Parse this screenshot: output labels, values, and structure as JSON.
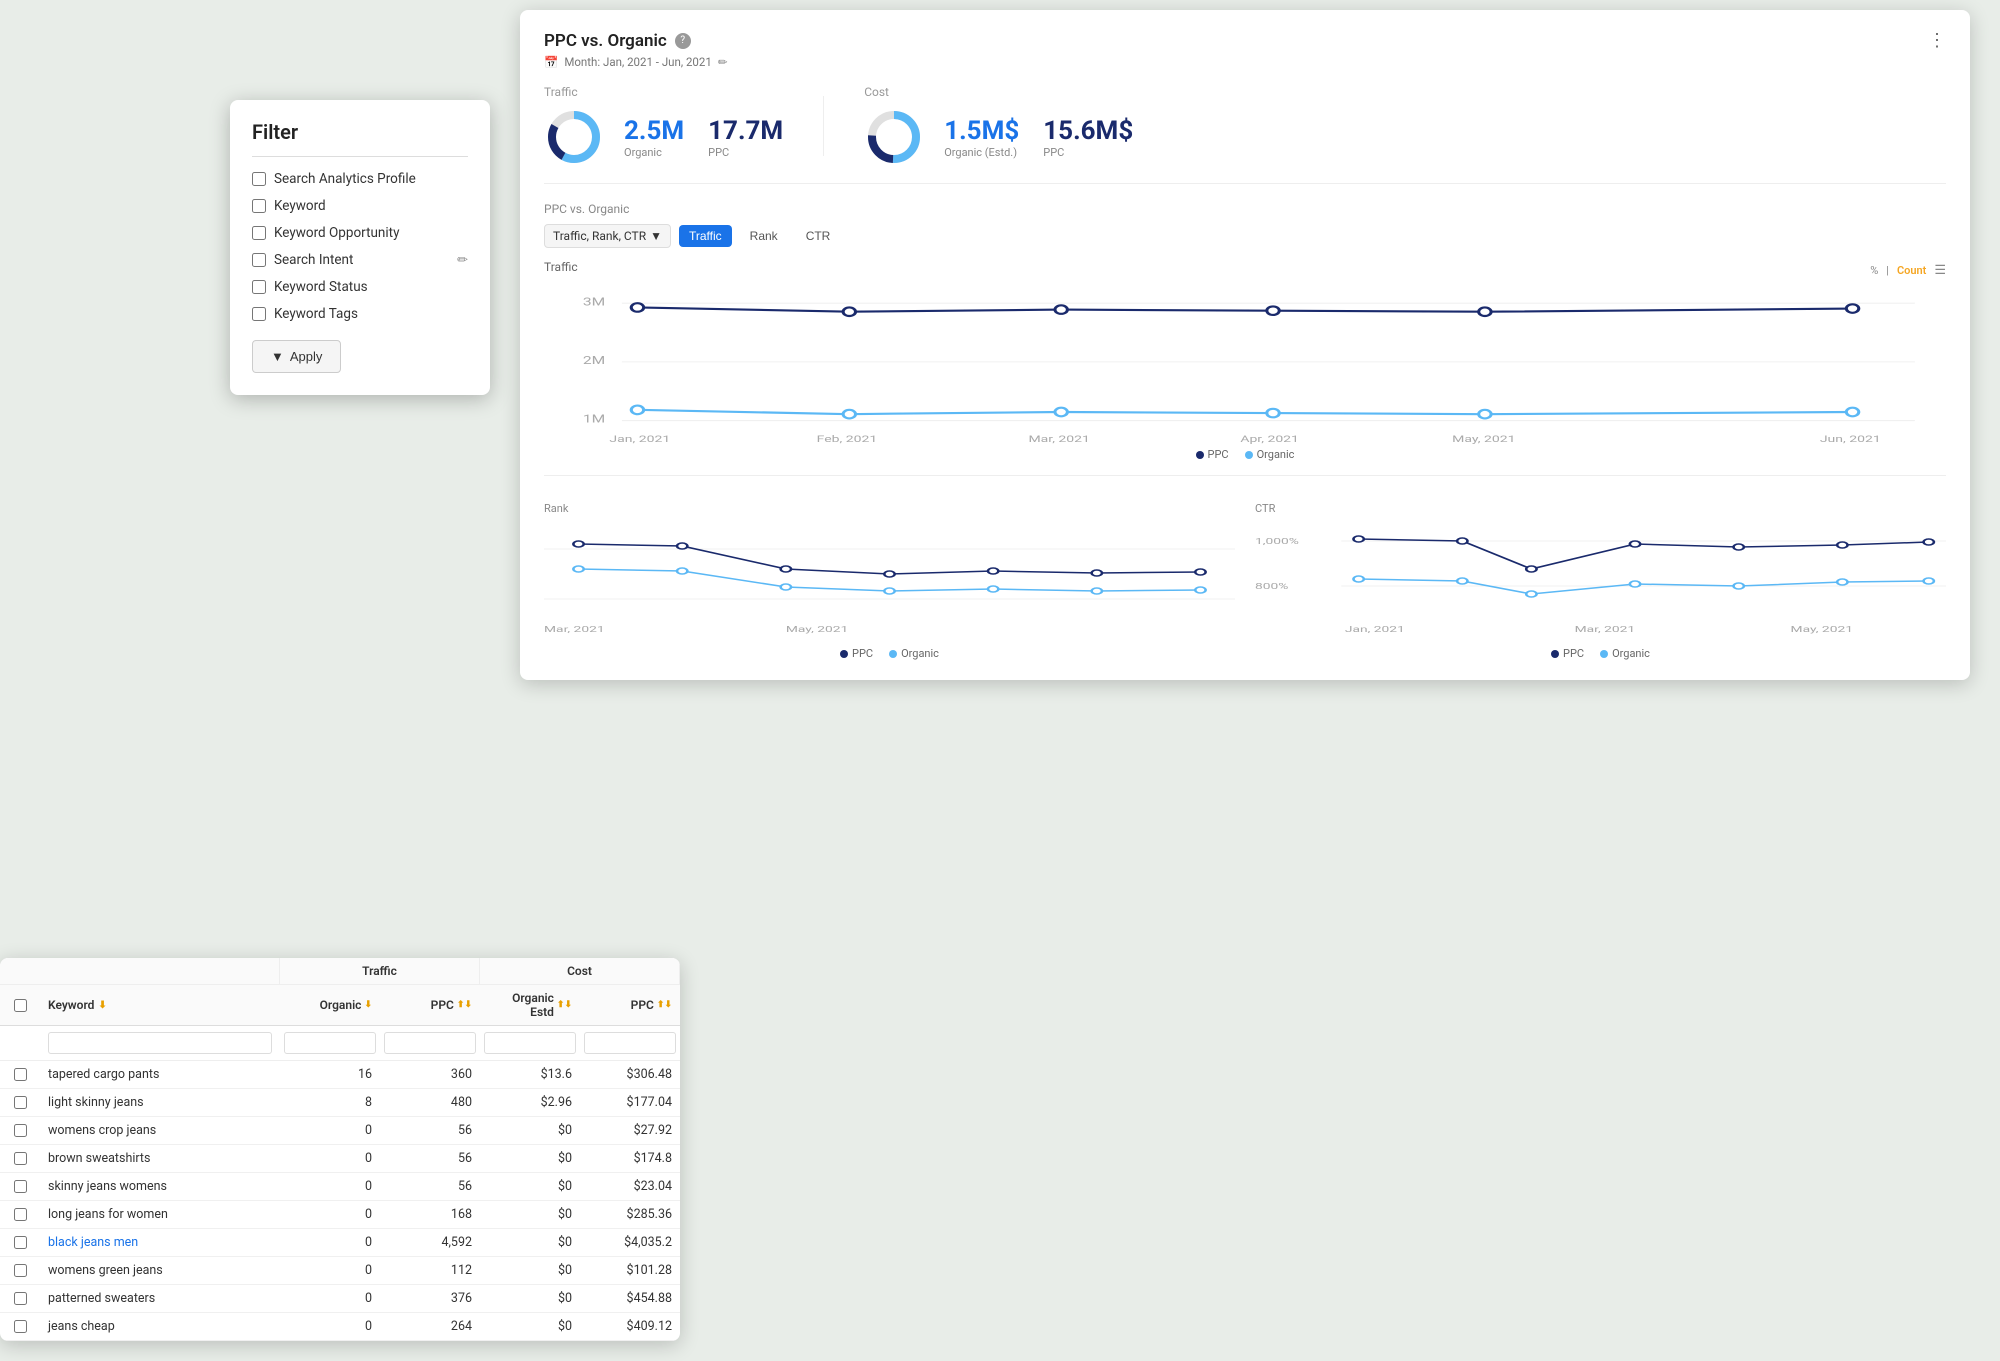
{
  "filter": {
    "title": "Filter",
    "items": [
      {
        "id": "search-analytics",
        "label": "Search Analytics Profile",
        "checked": false,
        "editable": false
      },
      {
        "id": "keyword",
        "label": "Keyword",
        "checked": false,
        "editable": false
      },
      {
        "id": "keyword-opportunity",
        "label": "Keyword Opportunity",
        "checked": false,
        "editable": false
      },
      {
        "id": "search-intent",
        "label": "Search Intent",
        "checked": false,
        "editable": true
      },
      {
        "id": "keyword-status",
        "label": "Keyword Status",
        "checked": false,
        "editable": false
      },
      {
        "id": "keyword-tags",
        "label": "Keyword Tags",
        "checked": false,
        "editable": false
      }
    ],
    "apply_label": "Apply"
  },
  "ppc": {
    "title": "PPC vs. Organic",
    "subtitle": "Month: Jan, 2021 - Jun, 2021",
    "traffic_label": "Traffic",
    "cost_label": "Cost",
    "organic_value": "2.5M",
    "ppc_traffic_value": "17.7M",
    "organic_label": "Organic",
    "ppc_label": "PPC",
    "organic_estd_value": "1.5M$",
    "ppc_cost_value": "15.6M$",
    "organic_estd_label": "Organic (Estd.)",
    "section_label": "PPC vs. Organic",
    "dropdown_label": "Traffic, Rank, CTR",
    "tabs": [
      "Traffic",
      "Rank",
      "CTR"
    ],
    "active_tab": "Traffic",
    "chart_label": "Traffic",
    "count_label": "Count",
    "percent_label": "%",
    "ppc_legend": "PPC",
    "organic_legend": "Organic",
    "x_labels": [
      "Jan, 2021",
      "Feb, 2021",
      "Mar, 2021",
      "Apr, 2021",
      "May, 2021",
      "Jun, 2021"
    ],
    "y_labels": [
      "3M",
      "2M",
      "1M"
    ],
    "rank_label": "Rank",
    "ctr_label": "CTR",
    "ctr_y_labels": [
      "1,000%",
      "800%"
    ],
    "ctr_x_labels": [
      "Jan, 2021",
      "Mar, 2021",
      "May, 2021"
    ]
  },
  "table": {
    "traffic_group": "Traffic",
    "cost_group": "Cost",
    "keyword_col": "Keyword",
    "organic_col": "Organic",
    "ppc_col": "PPC",
    "organic_estd_col": "Organic Estd",
    "ppc_cost_col": "PPC",
    "rows": [
      {
        "keyword": "tapered cargo pants",
        "organic": "16",
        "ppc": "360",
        "organic_estd": "$13.6",
        "ppc_cost": "$306.48",
        "link": false
      },
      {
        "keyword": "light skinny jeans",
        "organic": "8",
        "ppc": "480",
        "organic_estd": "$2.96",
        "ppc_cost": "$177.04",
        "link": false
      },
      {
        "keyword": "womens crop jeans",
        "organic": "0",
        "ppc": "56",
        "organic_estd": "$0",
        "ppc_cost": "$27.92",
        "link": false
      },
      {
        "keyword": "brown sweatshirts",
        "organic": "0",
        "ppc": "56",
        "organic_estd": "$0",
        "ppc_cost": "$174.8",
        "link": false
      },
      {
        "keyword": "skinny jeans womens",
        "organic": "0",
        "ppc": "56",
        "organic_estd": "$0",
        "ppc_cost": "$23.04",
        "link": false
      },
      {
        "keyword": "long jeans for women",
        "organic": "0",
        "ppc": "168",
        "organic_estd": "$0",
        "ppc_cost": "$285.36",
        "link": false
      },
      {
        "keyword": "black jeans men",
        "organic": "0",
        "ppc": "4,592",
        "organic_estd": "$0",
        "ppc_cost": "$4,035.2",
        "link": true
      },
      {
        "keyword": "womens green jeans",
        "organic": "0",
        "ppc": "112",
        "organic_estd": "$0",
        "ppc_cost": "$101.28",
        "link": false
      },
      {
        "keyword": "patterned sweaters",
        "organic": "0",
        "ppc": "376",
        "organic_estd": "$0",
        "ppc_cost": "$454.88",
        "link": false
      },
      {
        "keyword": "jeans cheap",
        "organic": "0",
        "ppc": "264",
        "organic_estd": "$0",
        "ppc_cost": "$409.12",
        "link": false
      }
    ]
  }
}
